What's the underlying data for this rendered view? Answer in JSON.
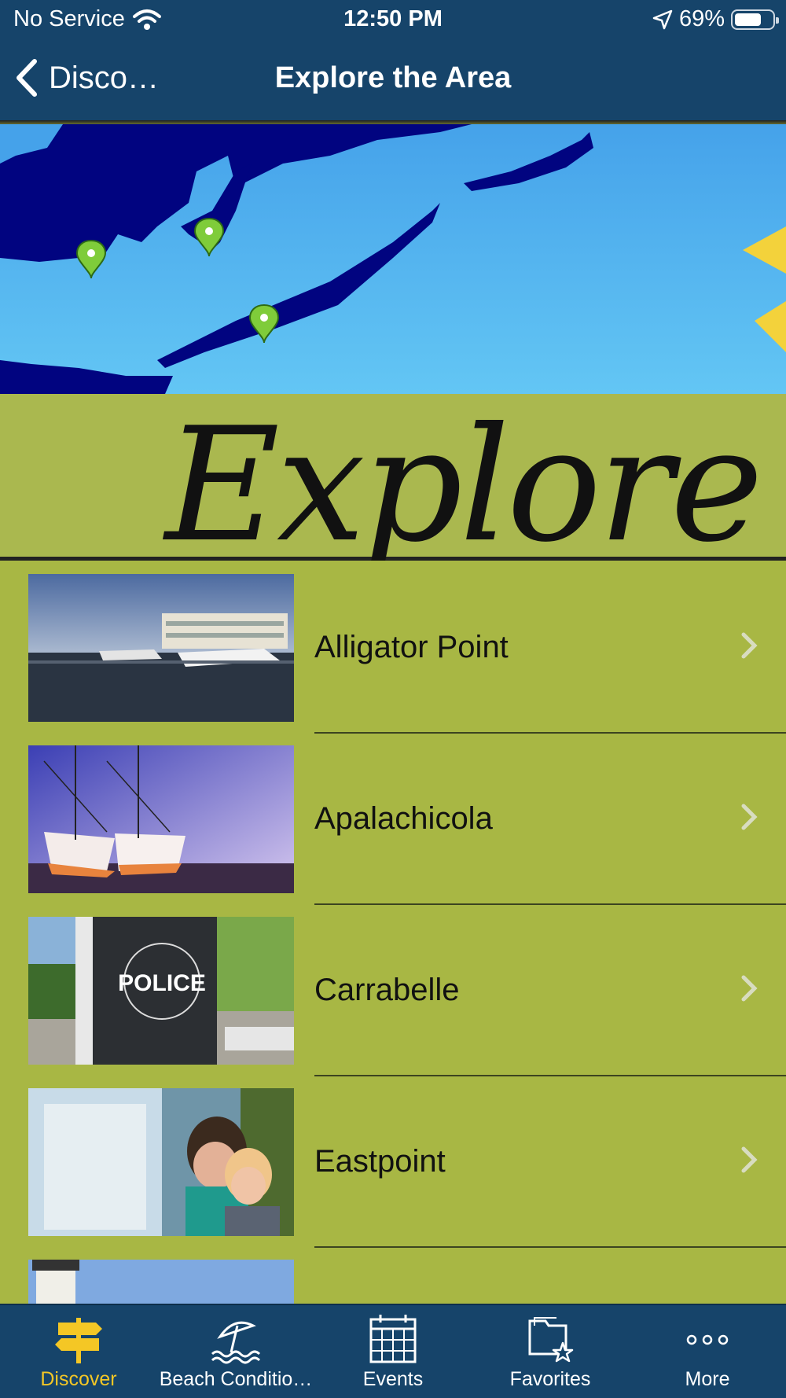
{
  "status_bar": {
    "carrier": "No Service",
    "time": "12:50 PM",
    "battery": "69%",
    "battery_level": 0.69
  },
  "nav": {
    "back_label": "Disco…",
    "title": "Explore the Area"
  },
  "hero": {
    "word": "Explore"
  },
  "list": {
    "items": [
      {
        "label": "Alligator Point",
        "thumb": "marina-photo"
      },
      {
        "label": "Apalachicola",
        "thumb": "shrimp-boats-photo"
      },
      {
        "label": "Carrabelle",
        "thumb": "police-station-photo",
        "thumb_text": "POLICE"
      },
      {
        "label": "Eastpoint",
        "thumb": "aquarium-photo"
      },
      {
        "label": "",
        "thumb": "lighthouse-photo"
      }
    ]
  },
  "tabbar": {
    "tabs": [
      {
        "label": "Discover",
        "icon": "signpost-icon",
        "active": true
      },
      {
        "label": "Beach Conditio…",
        "icon": "beach-umbrella-icon",
        "active": false
      },
      {
        "label": "Events",
        "icon": "calendar-icon",
        "active": false
      },
      {
        "label": "Favorites",
        "icon": "folder-star-icon",
        "active": false
      },
      {
        "label": "More",
        "icon": "more-dots-icon",
        "active": false
      }
    ]
  },
  "colors": {
    "bar": "#16446a",
    "list_bg": "#a8b744",
    "active_tab": "#f4c725"
  }
}
